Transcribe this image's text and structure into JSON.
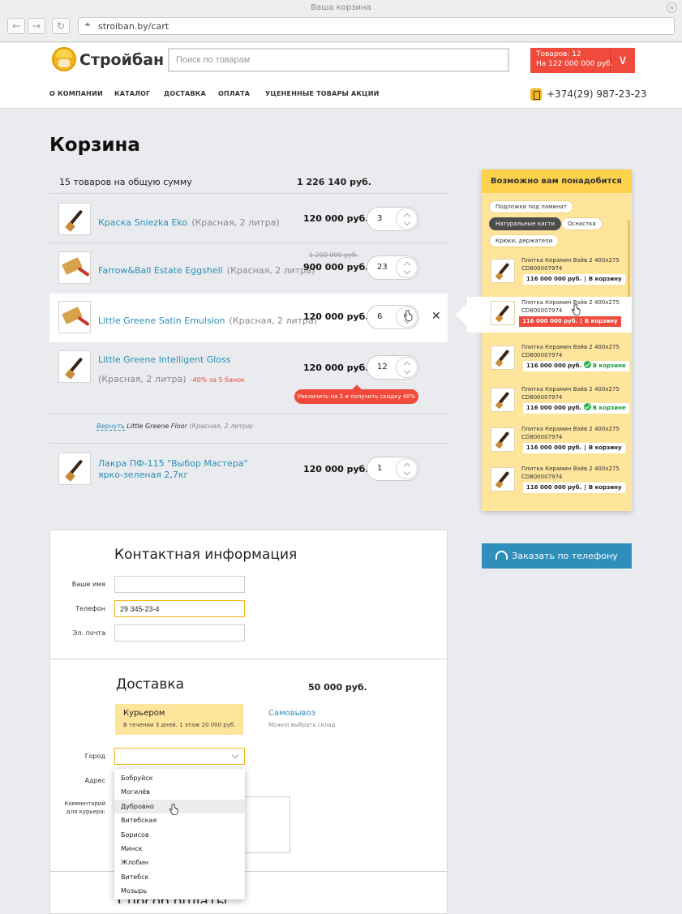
{
  "browser": {
    "window_title": "Ваша корзина",
    "url": "stroiban.by/cart",
    "back_glyph": "←",
    "forward_glyph": "→",
    "reload_glyph": "↻",
    "close_glyph": "×"
  },
  "header": {
    "logo_text": "Стройбан",
    "search_placeholder": "Поиск по товарам",
    "cart_count": "Товаров: 12",
    "cart_sum": "На 122 000 000 руб.",
    "cart_chevron": "∨",
    "menu": [
      "О КОМПАНИИ",
      "КАТАЛОГ",
      "ДОСТАВКА",
      "ОПЛАТА",
      "УЦЕНЕННЫЕ ТОВАРЫ",
      "АКЦИИ"
    ],
    "phone": "+374(29) 987-23-23"
  },
  "cart": {
    "title": "Корзина",
    "summary_label": "15 товаров на общую сумму",
    "summary_total": "1 226 140 руб.",
    "items": [
      {
        "name": "Краска Sniezka Eko",
        "variant": "(Красная, 2 литра)",
        "price": "120 000 руб.",
        "qty": "3"
      },
      {
        "name": "Farrow&Ball Estate Eggshell",
        "variant": "(Красная, 2 литра)",
        "old_price": "1 200 000 руб.",
        "price": "900 000 руб.",
        "qty": "23"
      },
      {
        "name": "Little Greene Satin Emulsion",
        "variant": "(Красная, 2 литра)",
        "price": "120 000 руб.",
        "qty": "6",
        "remove": "✕"
      },
      {
        "name": "Little Greene Intelligent Gloss",
        "variant": "(Красная, 2 литра)",
        "promo": "-40% за 5 банок",
        "price": "120 000 руб.",
        "qty": "12"
      },
      {
        "name_line1": "Лакра ПФ-115 \"Выбор Мастера\"",
        "name_line2": "ярко-зеленая 2,7кг",
        "price": "120 000 руб.",
        "qty": "1"
      }
    ],
    "discount_hint": "Увеличить на 2 и получить скидку 40%",
    "restore_link": "Вернуть",
    "restore_name": "Little Greene Floor",
    "restore_variant": "(Красная, 2 литра)"
  },
  "recommendations": {
    "title": "Возможно вам понадобится",
    "chips": [
      "Подложки под ламинат",
      "Натуральные кисти",
      "Оснастка",
      "Крюки, держатели"
    ],
    "product_name": "Плитка Керамин Вэйв 2 400x275",
    "product_code": "CD800007974",
    "price": "116 000 000 руб.",
    "separator": "|",
    "add_label": "В корзину",
    "in_cart_label": "В корзине"
  },
  "phone_order_label": "Заказать по телефону",
  "contact": {
    "title": "Контактная информация",
    "name_label": "Ваше имя",
    "name_value": "",
    "phone_label": "Телефон",
    "phone_value": "29 345-23-4",
    "email_label": "Эл. почта",
    "email_value": ""
  },
  "delivery": {
    "title": "Доставка",
    "price": "50 000 руб.",
    "courier_title": "Курьером",
    "courier_desc": "В течении 3 дней. 1 этаж 20 000 руб.",
    "pickup_title": "Самовывоз",
    "pickup_desc": "Можно выбрать склад",
    "city_label": "Город",
    "address_label": "Адрес",
    "comment_label_line1": "Комментарий",
    "comment_label_line2": "для курьера:",
    "cities": [
      "Бобруйск",
      "Могилёв",
      "Дубровно",
      "Витебская",
      "Борисов",
      "Минск",
      "Жлобин",
      "Витебск",
      "Мозырь"
    ]
  },
  "payment_title": "Способ оплаты"
}
